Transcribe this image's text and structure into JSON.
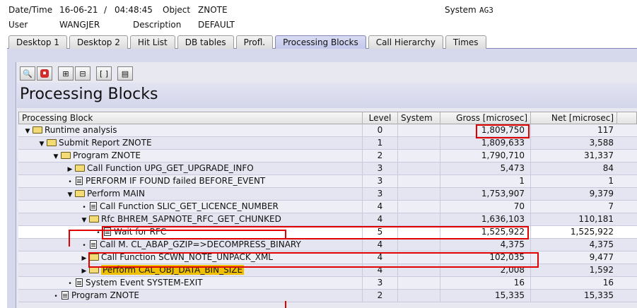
{
  "header": {
    "datetime_label": "Date/Time",
    "date": "16-06-21",
    "time_sep": "/",
    "time": "04:48:45",
    "object_label": "Object",
    "object_value": "ZNOTE",
    "system_label": "System",
    "system_value": "AG3",
    "user_label": "User",
    "user_value": "WANGJER",
    "description_label": "Description",
    "description_value": "DEFAULT"
  },
  "tabs": [
    {
      "label": "Desktop 1"
    },
    {
      "label": "Desktop 2"
    },
    {
      "label": "Hit List"
    },
    {
      "label": "DB tables"
    },
    {
      "label": "Profl."
    },
    {
      "label": "Processing Blocks"
    },
    {
      "label": "Call Hierarchy"
    },
    {
      "label": "Times"
    }
  ],
  "active_tab": "Processing Blocks",
  "toolbar_icons": [
    "binoculars-icon",
    "stop-icon",
    "expand-icon",
    "collapse-icon",
    "select-icon",
    "layout-icon"
  ],
  "toolbar_glyphs": [
    "🔍",
    "⏹",
    "⊞",
    "⊟",
    "[ ]",
    "▤"
  ],
  "page_title": "Processing Blocks",
  "columns": {
    "block": "Processing Block",
    "level": "Level",
    "system": "System",
    "gross": "Gross [microsec]",
    "net": "Net [microsec]"
  },
  "rows": [
    {
      "toggle": "▼",
      "icon": "folder",
      "name": "Runtime analysis",
      "level": "0",
      "system": "",
      "gross": "1,809,750",
      "net": "117"
    },
    {
      "toggle": "▼",
      "icon": "folder",
      "name": "Submit Report ZNOTE",
      "level": "1",
      "system": "",
      "gross": "1,809,633",
      "net": "3,588"
    },
    {
      "toggle": "▼",
      "icon": "folder",
      "name": "Program ZNOTE",
      "level": "2",
      "system": "",
      "gross": "1,790,710",
      "net": "31,337"
    },
    {
      "toggle": "▶",
      "icon": "folder",
      "name": "Call Function UPG_GET_UPGRADE_INFO",
      "level": "3",
      "system": "",
      "gross": "5,473",
      "net": "84"
    },
    {
      "toggle": "•",
      "icon": "doc",
      "name": "PERFORM IF FOUND failed BEFORE_EVENT",
      "level": "3",
      "system": "",
      "gross": "1",
      "net": "1"
    },
    {
      "toggle": "▼",
      "icon": "folder",
      "name": "Perform MAIN",
      "level": "3",
      "system": "",
      "gross": "1,753,907",
      "net": "9,379"
    },
    {
      "toggle": "•",
      "icon": "doc",
      "name": "Call Function SLIC_GET_LICENCE_NUMBER",
      "level": "4",
      "system": "",
      "gross": "70",
      "net": "7"
    },
    {
      "toggle": "▼",
      "icon": "folder",
      "name": "Rfc BHREM_SAPNOTE_RFC_GET_CHUNKED",
      "level": "4",
      "system": "",
      "gross": "1,636,103",
      "net": "110,181"
    },
    {
      "toggle": "•",
      "icon": "doc",
      "name": "Wait for RFC",
      "level": "5",
      "system": "",
      "gross": "1,525,922",
      "net": "1,525,922"
    },
    {
      "toggle": "•",
      "icon": "doc",
      "name": "Call M. CL_ABAP_GZIP=>DECOMPRESS_BINARY",
      "level": "4",
      "system": "",
      "gross": "4,375",
      "net": "4,375"
    },
    {
      "toggle": "▶",
      "icon": "folder",
      "name": "Call Function SCWN_NOTE_UNPACK_XML",
      "level": "4",
      "system": "",
      "gross": "102,035",
      "net": "9,477"
    },
    {
      "toggle": "▶",
      "icon": "folder",
      "name": "Perform CAL_OBJ_DATA_BIN_SIZE",
      "level": "4",
      "system": "",
      "gross": "2,008",
      "net": "1,592"
    },
    {
      "toggle": "•",
      "icon": "doc",
      "name": "System Event SYSTEM-EXIT",
      "level": "3",
      "system": "",
      "gross": "16",
      "net": "16"
    },
    {
      "toggle": "•",
      "icon": "doc",
      "name": "Program ZNOTE",
      "level": "2",
      "system": "",
      "gross": "15,335",
      "net": "15,335"
    }
  ],
  "colors": {
    "tab_active": "#c3c7ea",
    "annotation_red": "#e00000",
    "folder": "#f3dc76",
    "highlight_text": "#f0c000"
  }
}
